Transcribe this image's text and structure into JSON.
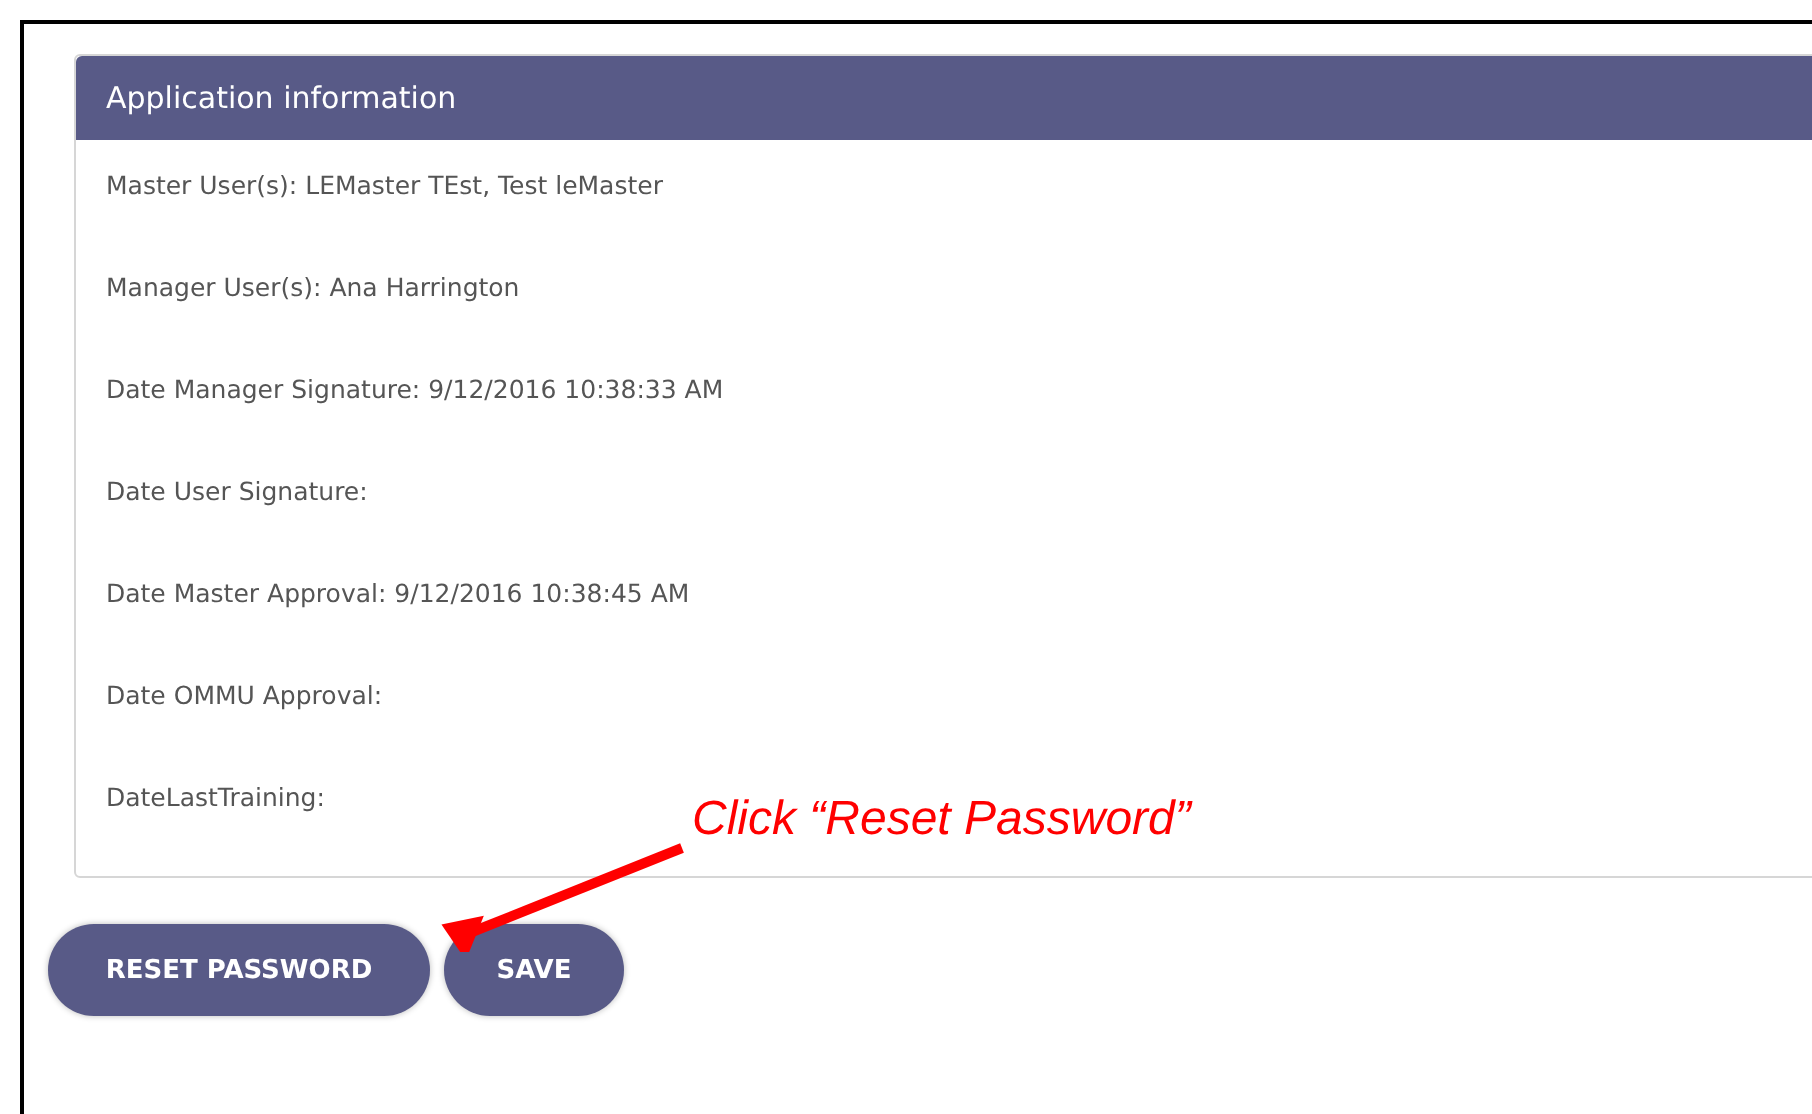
{
  "panel": {
    "title": "Application information",
    "fields": [
      {
        "label": "Master User(s):",
        "value": "LEMaster TEst, Test leMaster"
      },
      {
        "label": "Manager User(s):",
        "value": "Ana Harrington"
      },
      {
        "label": "Date Manager Signature:",
        "value": "9/12/2016 10:38:33 AM"
      },
      {
        "label": "Date User Signature:"
      },
      {
        "label": "Date Master Approval:",
        "value": "9/12/2016 10:38:45 AM"
      },
      {
        "label": "Date OMMU Approval:"
      },
      {
        "label": "DateLastTraining:"
      }
    ]
  },
  "buttons": [
    "RESET PASSWORD",
    "SAVE"
  ],
  "callout": {
    "text": "Click “Reset Password”"
  }
}
